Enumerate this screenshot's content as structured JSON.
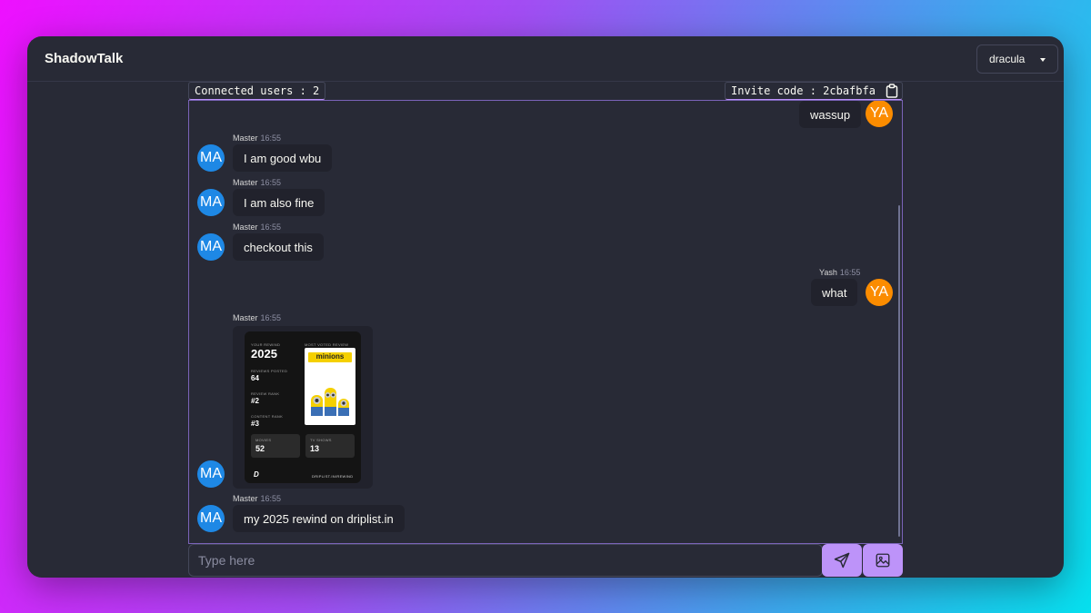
{
  "header": {
    "brand": "ShadowTalk",
    "theme": {
      "selected": "dracula"
    }
  },
  "status": {
    "connected_users": "Connected users : 2",
    "invite_code": "Invite code : 2cbafbfa"
  },
  "colors": {
    "accent": "#bd93f9",
    "avatar_master": "#1e88e5",
    "avatar_yash": "#fb8c00",
    "background": "#282a36"
  },
  "messages": [
    {
      "sender": "YA",
      "side": "right",
      "text": "wassup"
    },
    {
      "sender": "MA",
      "name": "Master",
      "time": "16:55",
      "side": "left",
      "text": "I am good wbu"
    },
    {
      "sender": "MA",
      "name": "Master",
      "time": "16:55",
      "side": "left",
      "text": "I am also fine"
    },
    {
      "sender": "MA",
      "name": "Master",
      "time": "16:55",
      "side": "left",
      "text": "checkout this"
    },
    {
      "sender": "YA",
      "name": "Yash",
      "time": "16:55",
      "side": "right",
      "text": "what"
    },
    {
      "sender": "MA",
      "name": "Master",
      "time": "16:55",
      "side": "left",
      "type": "image",
      "image": {
        "your_rewind": "YOUR REWIND",
        "year": "2025",
        "reviews_posted_label": "REVIEWS POSTED",
        "reviews_posted": "64",
        "review_rank_label": "REVIEW RANK",
        "review_rank": "#2",
        "content_rank_label": "CONTENT RANK",
        "content_rank": "#3",
        "most_voted_label": "MOST VOTED REVIEW",
        "poster_title": "minions",
        "movies_label": "MOVIES",
        "movies": "52",
        "tv_shows_label": "TV SHOWS",
        "tv_shows": "13",
        "logo": "D",
        "footer": "DRIPLIST.IN/REWIND"
      }
    },
    {
      "sender": "MA",
      "name": "Master",
      "time": "16:55",
      "side": "left",
      "text": "my 2025 rewind on driplist.in"
    }
  ],
  "composer": {
    "placeholder": "Type here",
    "send_icon": "send-icon",
    "image_icon": "image-upload-icon"
  }
}
